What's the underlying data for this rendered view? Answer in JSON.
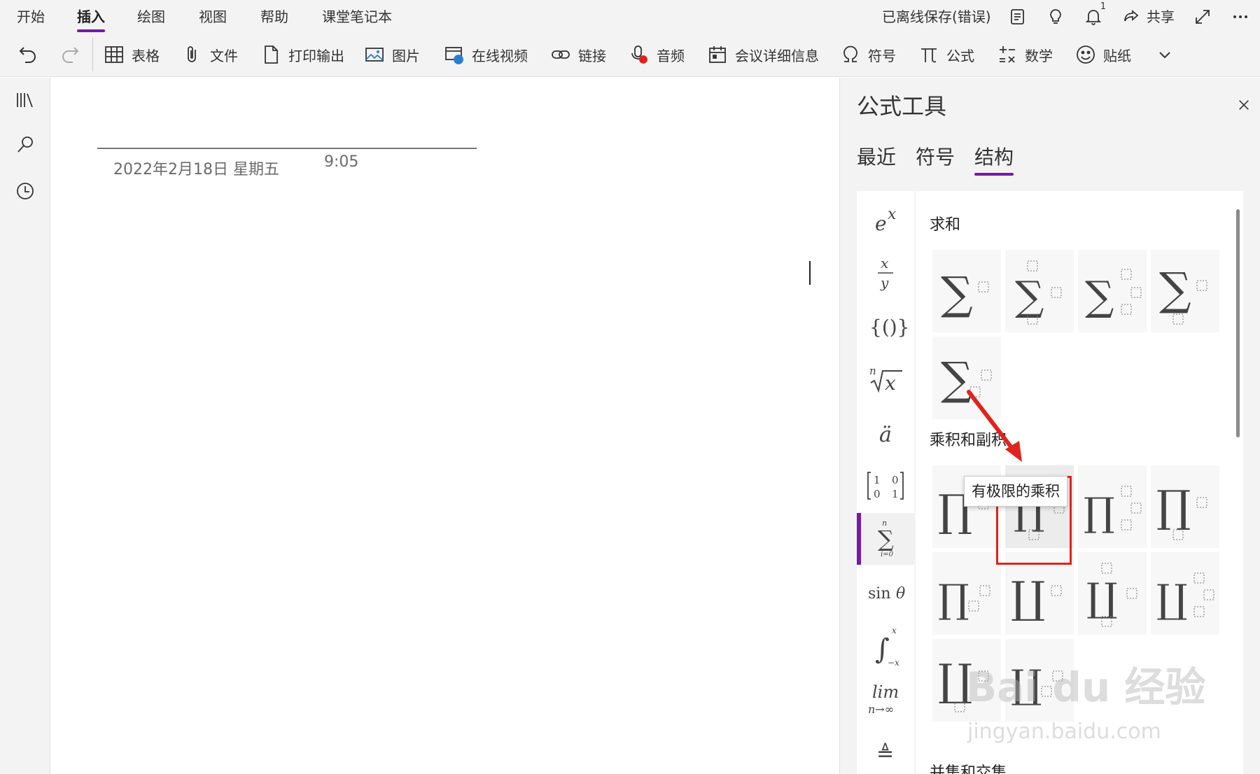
{
  "menu": {
    "tabs": [
      {
        "label": "开始",
        "active": false
      },
      {
        "label": "插入",
        "active": true
      },
      {
        "label": "绘图",
        "active": false
      },
      {
        "label": "视图",
        "active": false
      },
      {
        "label": "帮助",
        "active": false
      },
      {
        "label": "课堂笔记本",
        "active": false
      }
    ],
    "status": "已离线保存(错误)",
    "share_label": "共享",
    "notification_count": "1"
  },
  "toolbar": {
    "undo_icon": "undo-icon",
    "redo_icon": "redo-icon",
    "items": [
      {
        "label": "表格",
        "icon": "table-icon"
      },
      {
        "label": "文件",
        "icon": "paperclip-icon"
      },
      {
        "label": "打印输出",
        "icon": "file-icon"
      },
      {
        "label": "图片",
        "icon": "picture-icon"
      },
      {
        "label": "在线视频",
        "icon": "online-video-icon"
      },
      {
        "label": "链接",
        "icon": "link-icon"
      },
      {
        "label": "音频",
        "icon": "audio-icon"
      },
      {
        "label": "会议详细信息",
        "icon": "calendar-icon"
      },
      {
        "label": "符号",
        "icon": "omega-icon"
      },
      {
        "label": "公式",
        "icon": "pi-icon"
      },
      {
        "label": "数学",
        "icon": "math-icon"
      },
      {
        "label": "贴纸",
        "icon": "sticker-icon"
      }
    ]
  },
  "page": {
    "date": "2022年2月18日 星期五",
    "time": "9:05"
  },
  "pane": {
    "title": "公式工具",
    "tabs": [
      {
        "label": "最近",
        "active": false
      },
      {
        "label": "符号",
        "active": false
      },
      {
        "label": "结构",
        "active": true
      }
    ],
    "categories": [
      {
        "icon": "script-icon",
        "active": false
      },
      {
        "icon": "fraction-icon",
        "active": false
      },
      {
        "icon": "bracket-icon",
        "active": false
      },
      {
        "icon": "radical-icon",
        "active": false
      },
      {
        "icon": "accent-icon",
        "active": false
      },
      {
        "icon": "matrix-icon",
        "active": false
      },
      {
        "icon": "large-operator-icon",
        "active": true
      },
      {
        "icon": "function-icon",
        "active": false
      },
      {
        "icon": "integral-icon",
        "active": false
      },
      {
        "icon": "limit-log-icon",
        "active": false
      },
      {
        "icon": "operator-icon",
        "active": false
      }
    ],
    "sections": [
      {
        "title": "求和",
        "symbol": "sum"
      },
      {
        "title": "乘积和副积",
        "symbol": "product"
      },
      {
        "title": "并集和交集"
      }
    ],
    "tooltip": "有极限的乘积",
    "accent_color": "#7719aa",
    "annotation_color": "#e0231d"
  },
  "watermark": {
    "main": "Bai du 经验",
    "sub": "jingyan.baidu.com"
  }
}
